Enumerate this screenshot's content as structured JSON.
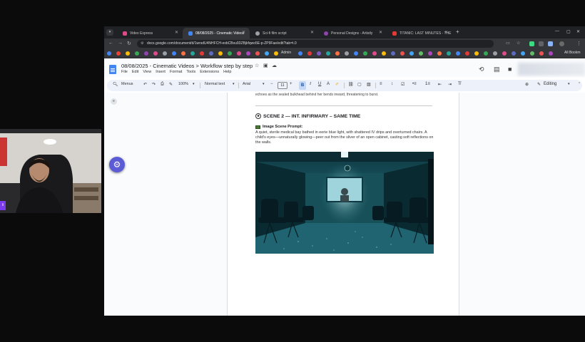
{
  "browser": {
    "tabs": [
      {
        "label": "Video Express",
        "icon_color": "#e04a8a",
        "active": false
      },
      {
        "label": "08/08/2025 - Cinematic Videos",
        "icon_color": "#4285f4",
        "active": true
      },
      {
        "label": "Sci-fi film script",
        "icon_color": "#9aa0a6",
        "active": false
      },
      {
        "label": "Personal Designs - Artistly",
        "icon_color": "#8e44ad",
        "active": false
      },
      {
        "label": "TITANIC: LAST MINUTES - THE",
        "icon_color": "#e53935",
        "active": false
      }
    ],
    "url": "docs.google.com/document/d/1wrsdU4NHFCH-exbCBxu93ZBjkfqwo5E-p-ZP9Fae/edit?tab=t.0",
    "bookmarks": {
      "admin_label": "Admin",
      "all_bookmarks_label": "All Bookm"
    }
  },
  "docs": {
    "title": "08/08/2025 - Cinematic Videos > Workflow step by step",
    "menu": [
      "File",
      "Edit",
      "View",
      "Insert",
      "Format",
      "Tools",
      "Extensions",
      "Help"
    ],
    "toolbar": {
      "menus": "Menus",
      "zoom": "100%",
      "style": "Normal text",
      "font": "Arial",
      "font_size": "11",
      "mode": "Editing"
    }
  },
  "document": {
    "prev_line_1": "echoes as the sealed bulkhead behind her bends inward, threatening to burst.",
    "scene_heading": "SCENE 2 — INT. INFIRMARY – SAME TIME",
    "prompt_label": "Image Scene Prompt:",
    "prompt_text": "A quiet, sterile medical bay bathed in eerie blue light, with shattered IV drips and overturned chairs. A child's eyes—unnaturally glowing—peer out from the sliver of an open cabinet, casting soft reflections on the walls."
  },
  "overlay": {
    "badge": "li"
  }
}
